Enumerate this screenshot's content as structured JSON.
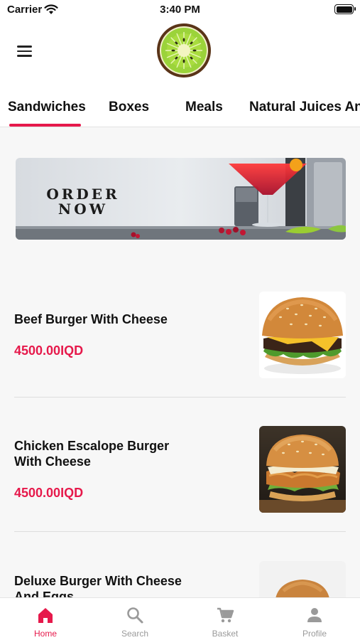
{
  "status_bar": {
    "carrier": "Carrier",
    "time": "3:40 PM",
    "icons": [
      "wifi-icon",
      "battery-icon"
    ]
  },
  "header": {
    "menu_icon": "hamburger-menu-icon",
    "logo": "kiwi-logo"
  },
  "tabs": {
    "active_index": 0,
    "items": [
      {
        "label": "Sandwiches"
      },
      {
        "label": "Boxes"
      },
      {
        "label": "Meals"
      },
      {
        "label": "Natural Juices An"
      }
    ]
  },
  "banner": {
    "line1": "ORDER",
    "line2": "NOW"
  },
  "products": [
    {
      "name": "Beef Burger With Cheese",
      "price": "4500.00IQD"
    },
    {
      "name": "Chicken Escalope Burger With Cheese",
      "price": "4500.00IQD"
    },
    {
      "name": "Deluxe Burger With Cheese And Eggs",
      "price": ""
    }
  ],
  "bottom_nav": {
    "active_index": 0,
    "items": [
      {
        "label": "Home",
        "icon": "home-icon"
      },
      {
        "label": "Search",
        "icon": "search-icon"
      },
      {
        "label": "Basket",
        "icon": "cart-icon"
      },
      {
        "label": "Profile",
        "icon": "profile-icon"
      }
    ]
  },
  "colors": {
    "accent": "#e6194b",
    "inactive": "#9a9a9a",
    "logo_green": "#9bd33a",
    "logo_rim": "#5a3418"
  }
}
